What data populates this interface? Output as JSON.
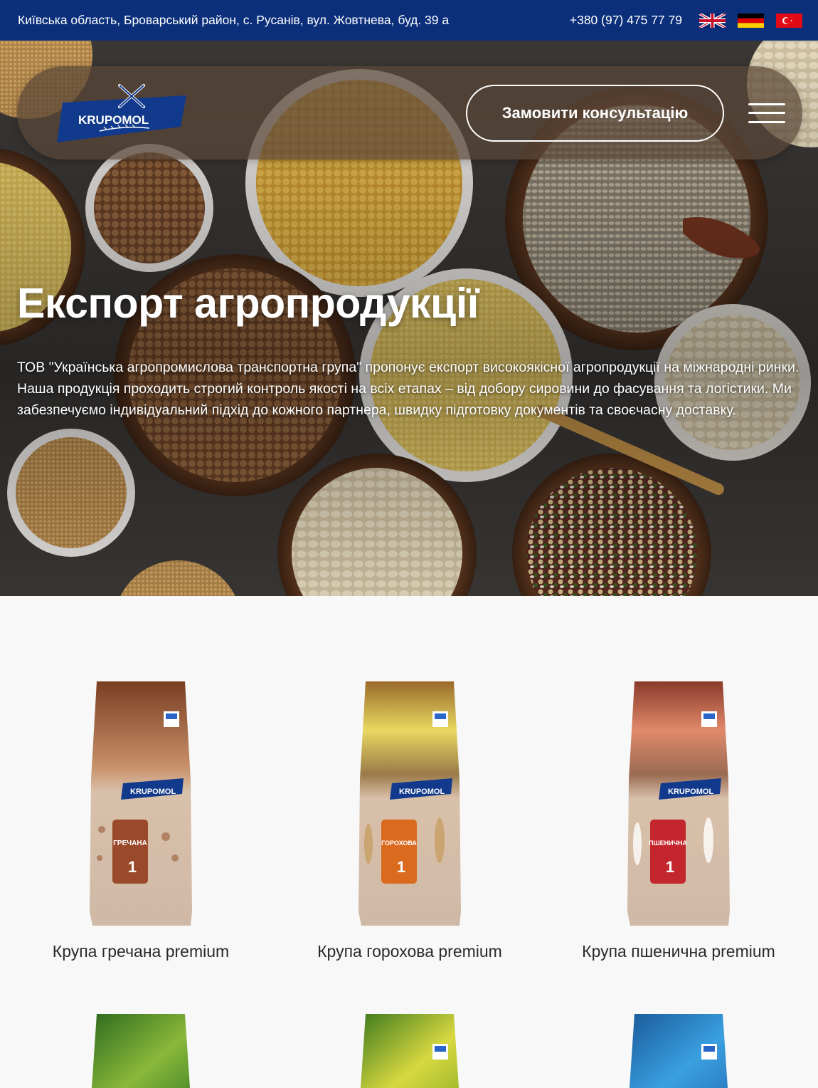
{
  "topbar": {
    "address": "Київська область, Броварський район, с. Русанів, вул. Жовтнева, буд. 39 а",
    "phone": "+380 (97) 475 77 79",
    "languages": [
      "en",
      "de",
      "tr"
    ]
  },
  "navbar": {
    "logo_text": "KRUPOMOL",
    "consult_label": "Замовити консультацію"
  },
  "hero": {
    "title": "Експорт агропродукції",
    "text": "ТОВ \"Українська агропромислова транспортна група\" пропонує експорт високоякісної агропродукції на міжнародні ринки. Наша продукція проходить строгий контроль якості на всіх етапах – від добору сировини до фасування та логістики. Ми забезпечуємо індивідуальний підхід до кожного партнера, швидку підготовку документів та своєчасну доставку."
  },
  "products": [
    {
      "name": "Крупа гречана premium",
      "label": "ГРЕЧАНА",
      "weight": "1",
      "color": "#9a4a2a"
    },
    {
      "name": "Крупа горохова premium",
      "label": "ГОРОХОВА",
      "weight": "1",
      "color": "#d96a1e"
    },
    {
      "name": "Крупа пшенична premium",
      "label": "ПШЕНИЧНА",
      "weight": "1",
      "color": "#c4262e"
    },
    {
      "name": "",
      "color": "#4a8a2a"
    },
    {
      "name": "",
      "color": "#9ab82a"
    },
    {
      "name": "",
      "color": "#2a7ac0"
    }
  ],
  "colors": {
    "topbar": "#0b2f7a",
    "brand_blue": "#123a8c"
  }
}
